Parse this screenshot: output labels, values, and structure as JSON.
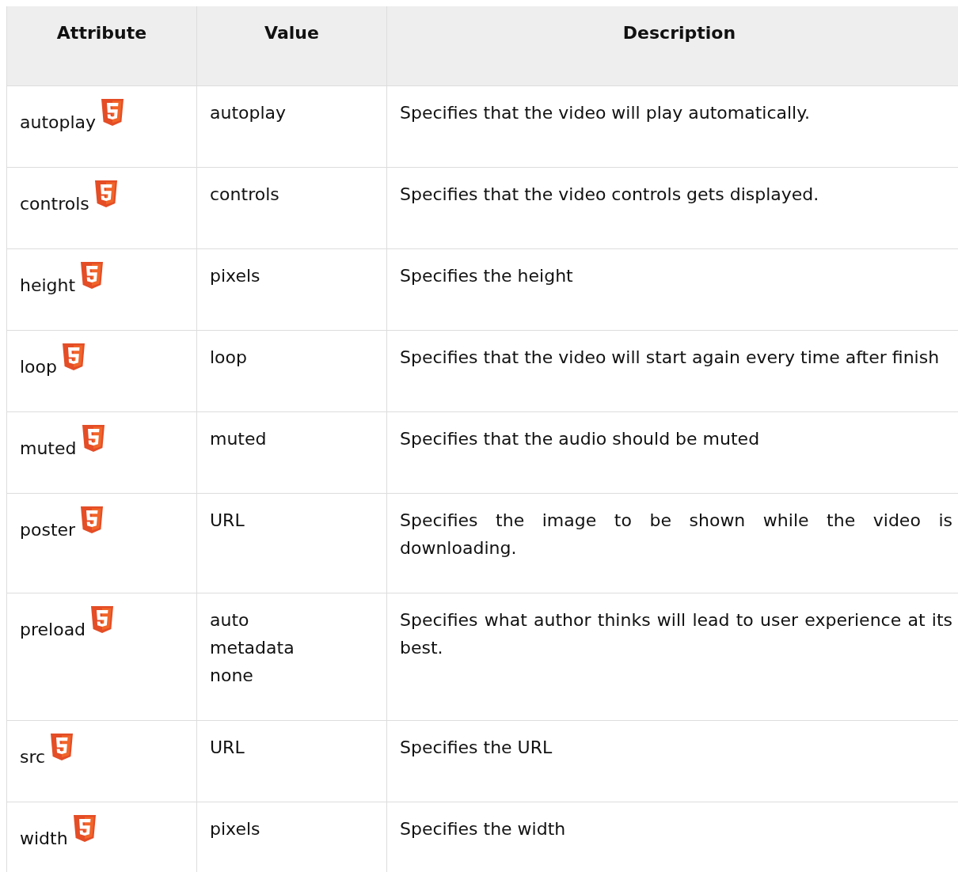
{
  "table": {
    "columns": [
      "Attribute",
      "Value",
      "Description"
    ],
    "rows": [
      {
        "attribute": "autoplay",
        "values": [
          "autoplay"
        ],
        "description": "Specifies that the video will play automatically."
      },
      {
        "attribute": "controls",
        "values": [
          "controls"
        ],
        "description": "Specifies that the video controls gets displayed."
      },
      {
        "attribute": "height",
        "values": [
          "pixels"
        ],
        "description": "Specifies the height"
      },
      {
        "attribute": "loop",
        "values": [
          "loop"
        ],
        "description": "Specifies that the video will start again every time after finish"
      },
      {
        "attribute": "muted",
        "values": [
          "muted"
        ],
        "description": "Specifies that the audio should be muted"
      },
      {
        "attribute": "poster",
        "values": [
          "URL"
        ],
        "description": "Specifies the image to be shown while the video is downloading."
      },
      {
        "attribute": "preload",
        "values": [
          "auto",
          "metadata",
          "none"
        ],
        "description": "Specifies what author thinks will lead to user experience at its best."
      },
      {
        "attribute": "src",
        "values": [
          "URL"
        ],
        "description": "Specifies the URL"
      },
      {
        "attribute": "width",
        "values": [
          "pixels"
        ],
        "description": "Specifies the width"
      }
    ]
  }
}
